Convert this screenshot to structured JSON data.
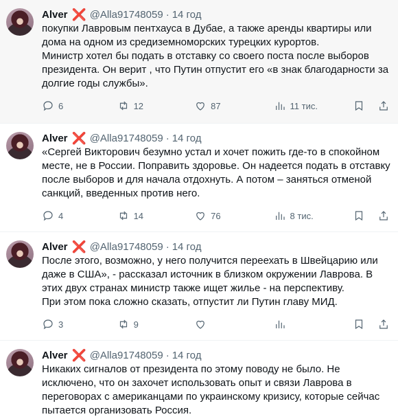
{
  "tweets": [
    {
      "name": "Alver",
      "badge": "❌",
      "handle": "@Alla91748059",
      "sep": "·",
      "time": "14 год",
      "lines": [
        "покупки Лавровым пентхауса в Дубае, а также аренды квартиры или",
        "дома на одном из средиземноморских турецких курортов.",
        "Министр хотел бы подать в отставку со своего поста после выборов",
        "президента. Он верит , что  Путин отпустит его «в знак благодарности за",
        "долгие годы службы»."
      ],
      "replies": "6",
      "retweets": "12",
      "likes": "87",
      "views": "11 тис."
    },
    {
      "name": "Alver",
      "badge": "❌",
      "handle": "@Alla91748059",
      "sep": "·",
      "time": "14 год",
      "lines": [
        "«Сергей Викторович безумно устал и хочет пожить где-то в спокойном",
        "месте, не в России. Поправить здоровье. Он надеется подать в отставку",
        "после выборов и для начала отдохнуть. А потом – заняться отменой",
        "санкций, введенных против него."
      ],
      "replies": "4",
      "retweets": "14",
      "likes": "76",
      "views": "8 тис."
    },
    {
      "name": "Alver",
      "badge": "❌",
      "handle": "@Alla91748059",
      "sep": "·",
      "time": "14 год",
      "lines": [
        "После этого, возможно, у него получится переехать в Швейцарию или",
        "даже в США», - рассказал  источник в близком окружении Лаврова. В",
        "этих двух странах министр также ищет жилье - на перспективу.",
        "При этом пока сложно сказать, отпустит ли Путин главу МИД."
      ],
      "replies": "3",
      "retweets": "9",
      "likes": "",
      "views": ""
    },
    {
      "name": "Alver",
      "badge": "❌",
      "handle": "@Alla91748059",
      "sep": "·",
      "time": "14 год",
      "lines": [
        "Никаких сигналов от президента по этому поводу не было. Не",
        "исключено, что он захочет использовать опыт и связи Лаврова в",
        "переговорах с американцами  по украинскому кризису, которые сейчас",
        "пытается организовать Россия."
      ],
      "replies": "",
      "retweets": "",
      "likes": "",
      "views": ""
    }
  ]
}
